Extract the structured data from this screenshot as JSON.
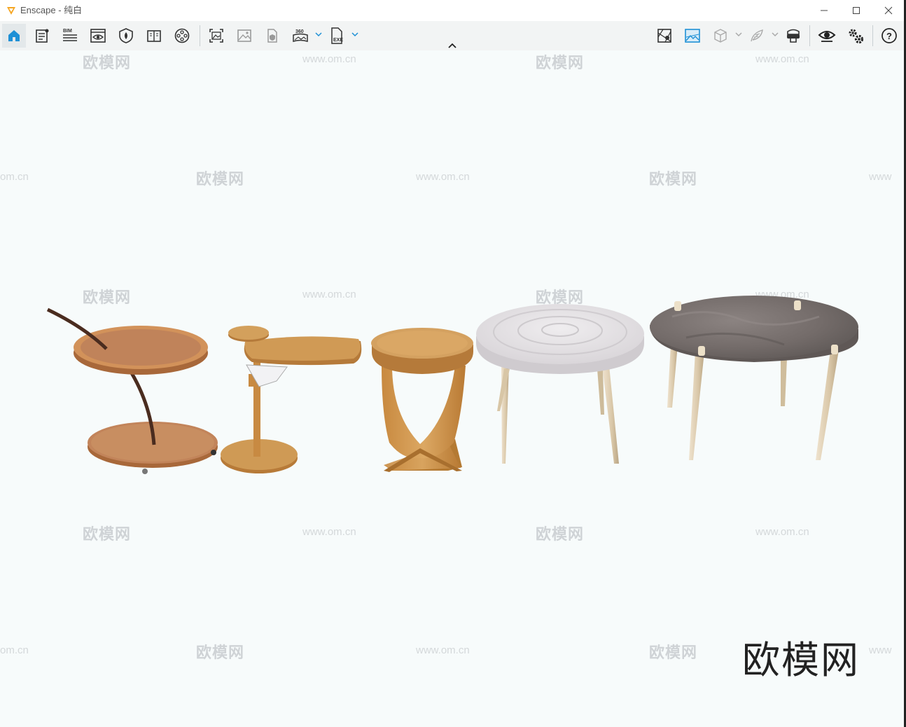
{
  "window": {
    "app_title": "Enscape - 纯白",
    "controls": {
      "minimize": "minimize",
      "maximize": "maximize",
      "close": "close"
    }
  },
  "toolbar": {
    "left_tools": [
      {
        "name": "home-icon",
        "active": true
      },
      {
        "name": "document-icon"
      },
      {
        "name": "bim-icon",
        "label": "BIM"
      },
      {
        "name": "view-eye-icon"
      },
      {
        "name": "shield-light-icon"
      },
      {
        "name": "book-icon"
      },
      {
        "name": "film-reel-icon"
      }
    ],
    "render_tools": [
      {
        "name": "screenshot-icon"
      },
      {
        "name": "image-icon"
      },
      {
        "name": "file-shield-icon"
      },
      {
        "name": "panorama-icon",
        "label": "360"
      },
      {
        "name": "exe-file-icon",
        "label": "EXE"
      }
    ],
    "right_tools": [
      {
        "name": "map-icon"
      },
      {
        "name": "picture-icon"
      },
      {
        "name": "cube-icon"
      },
      {
        "name": "feather-icon"
      },
      {
        "name": "vr-headset-icon"
      },
      {
        "name": "visual-settings-eye-icon"
      },
      {
        "name": "settings-gears-icon"
      },
      {
        "name": "help-icon"
      }
    ]
  },
  "watermarks": {
    "logo_text": "欧模网",
    "url_text": "www.om.cn",
    "url_partial_left": "om.cn",
    "url_partial_right": "www"
  },
  "corner_mark": "欧模网",
  "colors": {
    "accent_blue": "#1e90d6",
    "background": "#f7fbfb",
    "wood": "#c9874a",
    "oak": "#cf9a55",
    "white_marble": "#e6e4e6",
    "grey_marble": "#7b7472"
  }
}
